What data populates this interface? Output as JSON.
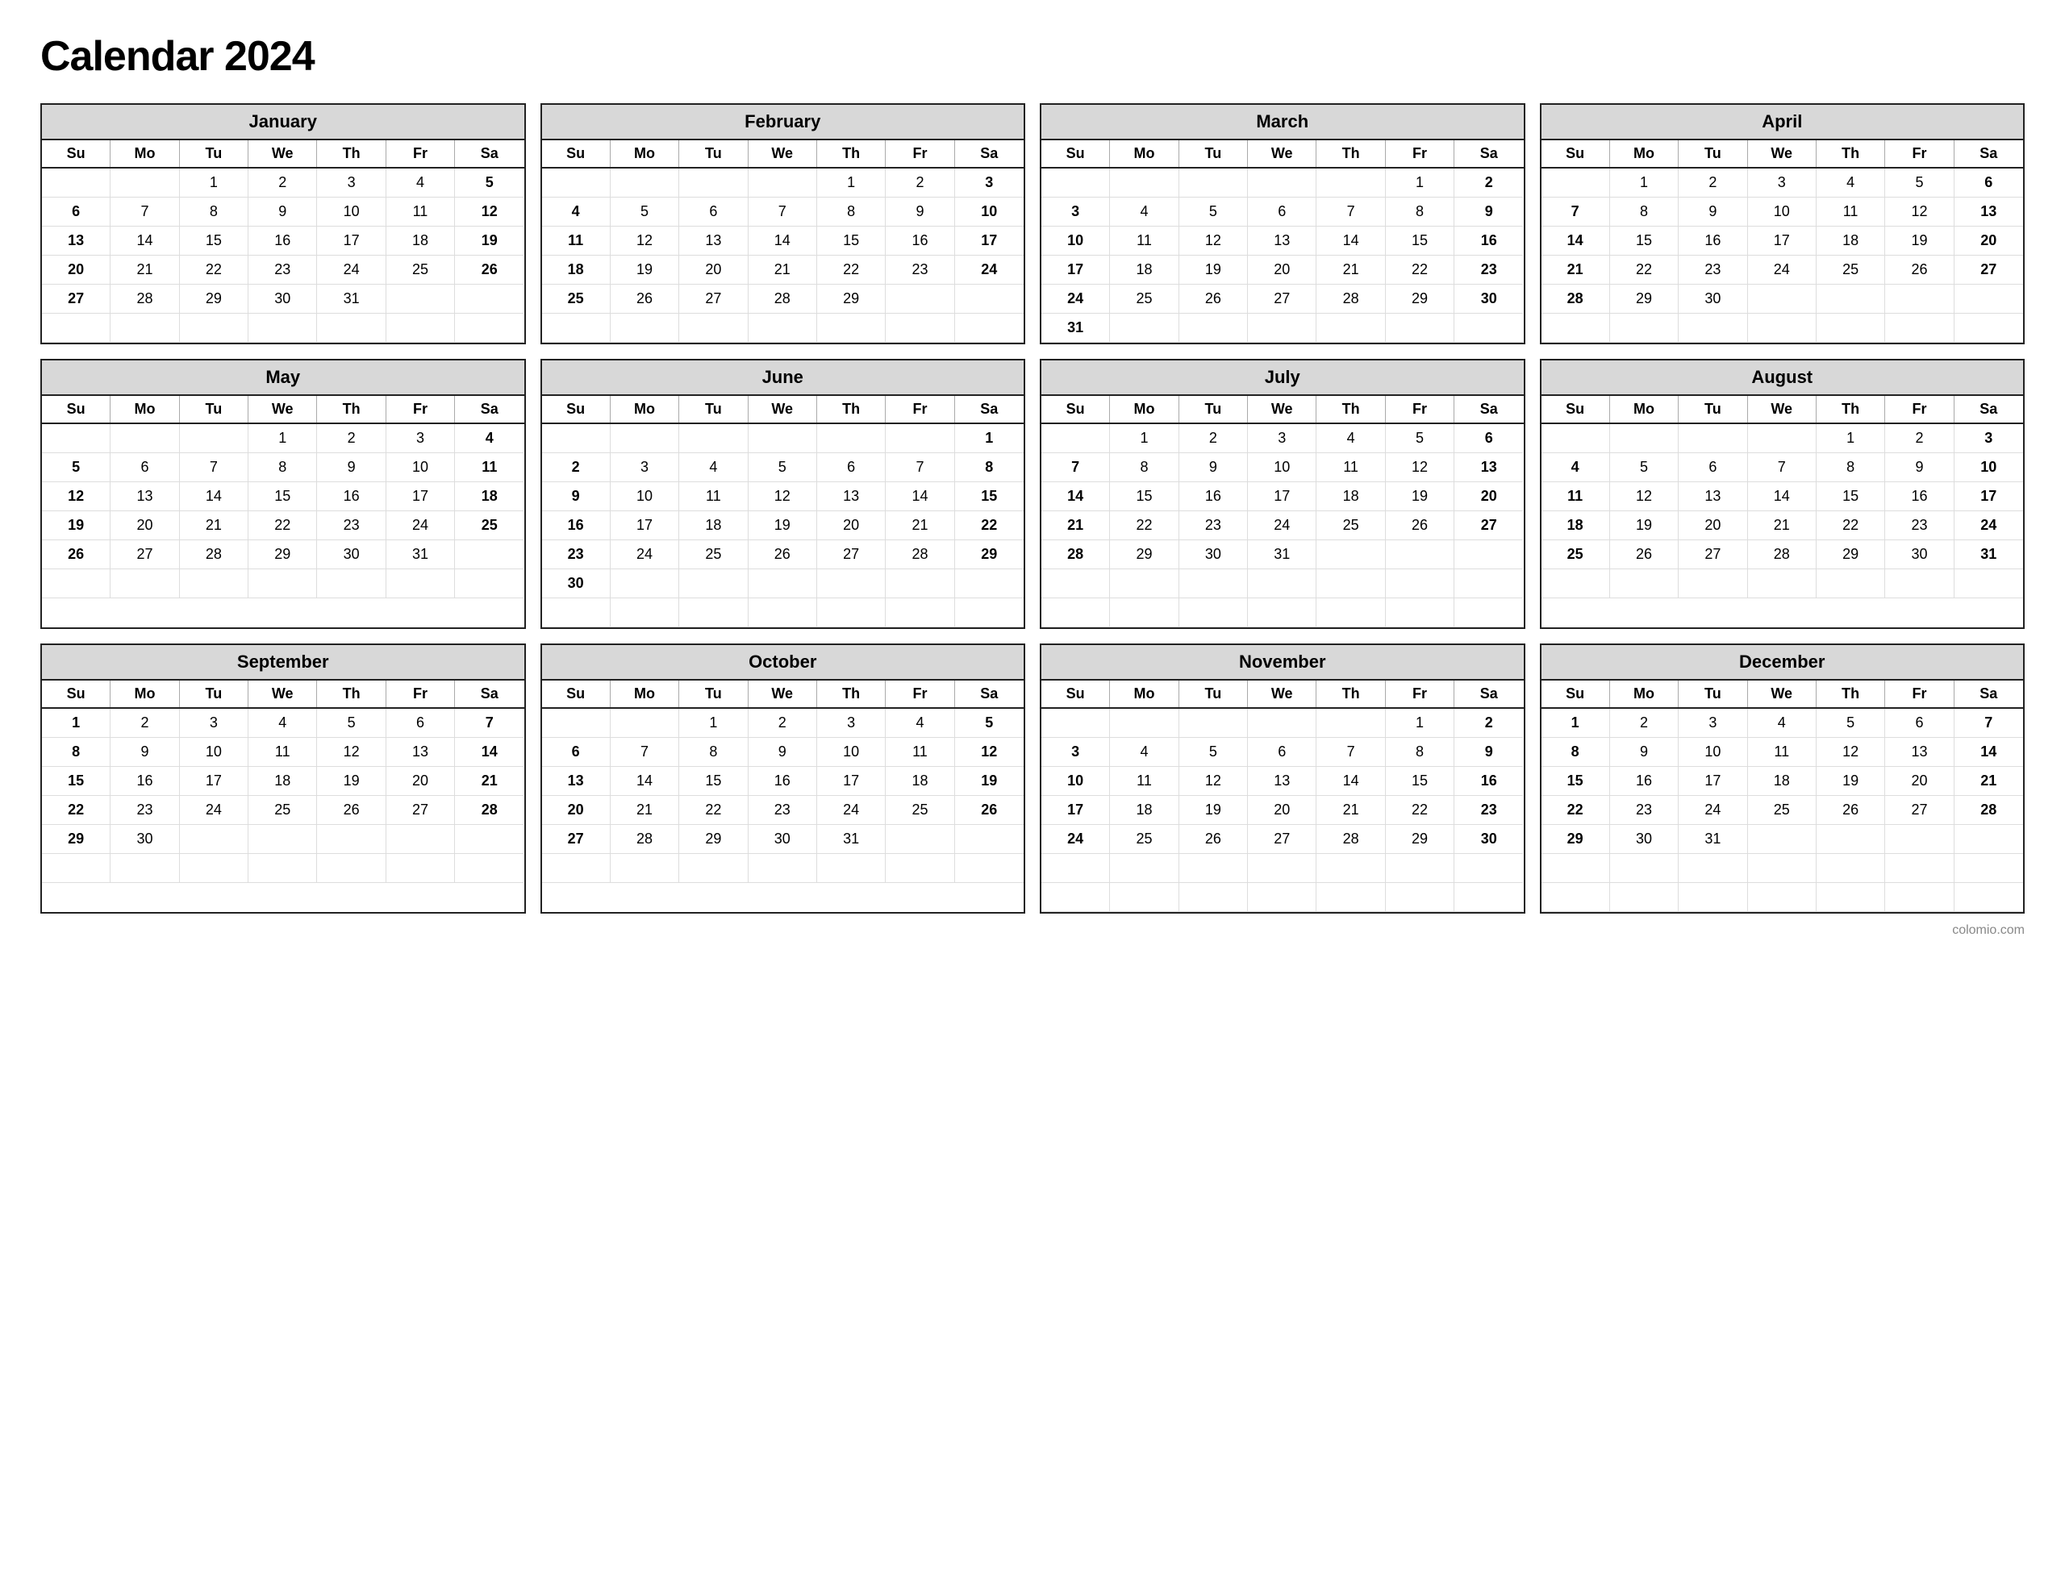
{
  "title": "Calendar 2024",
  "footer": "colomio.com",
  "months": [
    {
      "name": "January",
      "days": [
        "",
        "",
        "1",
        "2",
        "3",
        "4",
        "5",
        "6",
        "7",
        "8",
        "9",
        "10",
        "11",
        "12",
        "13",
        "14",
        "15",
        "16",
        "17",
        "18",
        "19",
        "20",
        "21",
        "22",
        "23",
        "24",
        "25",
        "26",
        "27",
        "28",
        "29",
        "30",
        "31",
        "",
        "",
        "",
        "",
        "",
        "",
        "",
        "",
        ""
      ]
    },
    {
      "name": "February",
      "days": [
        "",
        "",
        "",
        "",
        "1",
        "2",
        "3",
        "4",
        "5",
        "6",
        "7",
        "8",
        "9",
        "10",
        "11",
        "12",
        "13",
        "14",
        "15",
        "16",
        "17",
        "18",
        "19",
        "20",
        "21",
        "22",
        "23",
        "24",
        "25",
        "26",
        "27",
        "28",
        "29",
        "",
        "",
        "",
        "",
        "",
        "",
        "",
        "",
        ""
      ]
    },
    {
      "name": "March",
      "days": [
        "",
        "",
        "",
        "",
        "",
        "1",
        "2",
        "3",
        "4",
        "5",
        "6",
        "7",
        "8",
        "9",
        "10",
        "11",
        "12",
        "13",
        "14",
        "15",
        "16",
        "17",
        "18",
        "19",
        "20",
        "21",
        "22",
        "23",
        "24",
        "25",
        "26",
        "27",
        "28",
        "29",
        "30",
        "31",
        "",
        "",
        "",
        "",
        "",
        ""
      ]
    },
    {
      "name": "April",
      "days": [
        "",
        "1",
        "2",
        "3",
        "4",
        "5",
        "6",
        "7",
        "8",
        "9",
        "10",
        "11",
        "12",
        "13",
        "14",
        "15",
        "16",
        "17",
        "18",
        "19",
        "20",
        "21",
        "22",
        "23",
        "24",
        "25",
        "26",
        "27",
        "28",
        "29",
        "30",
        "",
        "",
        "",
        "",
        "",
        "",
        "",
        "",
        "",
        "",
        ""
      ]
    },
    {
      "name": "May",
      "days": [
        "",
        "",
        "",
        "1",
        "2",
        "3",
        "4",
        "5",
        "6",
        "7",
        "8",
        "9",
        "10",
        "11",
        "12",
        "13",
        "14",
        "15",
        "16",
        "17",
        "18",
        "19",
        "20",
        "21",
        "22",
        "23",
        "24",
        "25",
        "26",
        "27",
        "28",
        "29",
        "30",
        "31",
        "",
        "",
        "",
        "",
        "",
        "",
        "",
        ""
      ]
    },
    {
      "name": "June",
      "days": [
        "",
        "",
        "",
        "",
        "",
        "",
        "1",
        "2",
        "3",
        "4",
        "5",
        "6",
        "7",
        "8",
        "9",
        "10",
        "11",
        "12",
        "13",
        "14",
        "15",
        "16",
        "17",
        "18",
        "19",
        "20",
        "21",
        "22",
        "23",
        "24",
        "25",
        "26",
        "27",
        "28",
        "29",
        "30",
        "",
        "",
        "",
        "",
        "",
        "",
        ""
      ]
    },
    {
      "name": "July",
      "days": [
        "",
        "1",
        "2",
        "3",
        "4",
        "5",
        "6",
        "7",
        "8",
        "9",
        "10",
        "11",
        "12",
        "13",
        "14",
        "15",
        "16",
        "17",
        "18",
        "19",
        "20",
        "21",
        "22",
        "23",
        "24",
        "25",
        "26",
        "27",
        "28",
        "29",
        "30",
        "31",
        "",
        "",
        "",
        "",
        "",
        "",
        "",
        "",
        "",
        "",
        ""
      ]
    },
    {
      "name": "August",
      "days": [
        "",
        "",
        "",
        "",
        "1",
        "2",
        "3",
        "4",
        "5",
        "6",
        "7",
        "8",
        "9",
        "10",
        "11",
        "12",
        "13",
        "14",
        "15",
        "16",
        "17",
        "18",
        "19",
        "20",
        "21",
        "22",
        "23",
        "24",
        "25",
        "26",
        "27",
        "28",
        "29",
        "30",
        "31",
        "",
        "",
        "",
        "",
        "",
        "",
        ""
      ]
    },
    {
      "name": "September",
      "days": [
        "1",
        "2",
        "3",
        "4",
        "5",
        "6",
        "7",
        "8",
        "9",
        "10",
        "11",
        "12",
        "13",
        "14",
        "15",
        "16",
        "17",
        "18",
        "19",
        "20",
        "21",
        "22",
        "23",
        "24",
        "25",
        "26",
        "27",
        "28",
        "29",
        "30",
        "",
        "",
        "",
        "",
        "",
        "",
        "",
        "",
        "",
        "",
        "",
        ""
      ]
    },
    {
      "name": "October",
      "days": [
        "",
        "",
        "1",
        "2",
        "3",
        "4",
        "5",
        "6",
        "7",
        "8",
        "9",
        "10",
        "11",
        "12",
        "13",
        "14",
        "15",
        "16",
        "17",
        "18",
        "19",
        "20",
        "21",
        "22",
        "23",
        "24",
        "25",
        "26",
        "27",
        "28",
        "29",
        "30",
        "31",
        "",
        "",
        "",
        "",
        "",
        "",
        "",
        "",
        ""
      ]
    },
    {
      "name": "November",
      "days": [
        "",
        "",
        "",
        "",
        "",
        "1",
        "2",
        "3",
        "4",
        "5",
        "6",
        "7",
        "8",
        "9",
        "10",
        "11",
        "12",
        "13",
        "14",
        "15",
        "16",
        "17",
        "18",
        "19",
        "20",
        "21",
        "22",
        "23",
        "24",
        "25",
        "26",
        "27",
        "28",
        "29",
        "30",
        "",
        "",
        "",
        "",
        "",
        "",
        "",
        ""
      ]
    },
    {
      "name": "December",
      "days": [
        "1",
        "2",
        "3",
        "4",
        "5",
        "6",
        "7",
        "8",
        "9",
        "10",
        "11",
        "12",
        "13",
        "14",
        "15",
        "16",
        "17",
        "18",
        "19",
        "20",
        "21",
        "22",
        "23",
        "24",
        "25",
        "26",
        "27",
        "28",
        "29",
        "30",
        "31",
        "",
        "",
        "",
        "",
        "",
        "",
        "",
        "",
        "",
        "",
        "",
        ""
      ]
    }
  ],
  "day_headers": [
    "Su",
    "Mo",
    "Tu",
    "We",
    "Th",
    "Fr",
    "Sa"
  ]
}
